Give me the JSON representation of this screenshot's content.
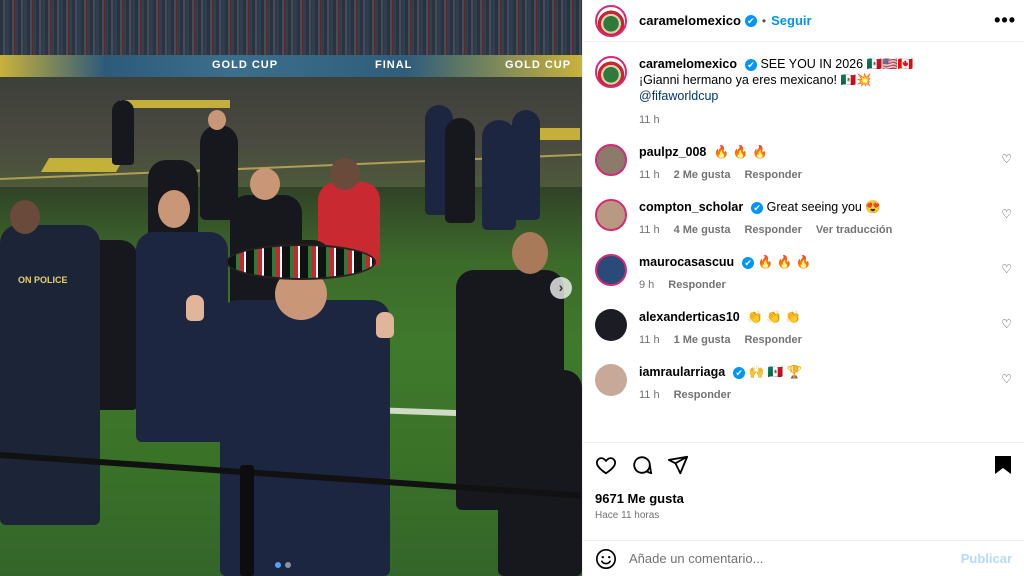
{
  "media": {
    "ad_board_texts": [
      "GOLD CUP",
      "FINAL",
      "GOLD CUP"
    ],
    "jacket_text": "ON POLICE",
    "next_icon": "chevron-right-icon"
  },
  "header": {
    "username": "caramelomexico",
    "verified_glyph": "✔",
    "separator": "•",
    "follow_label": "Seguir",
    "more_label": "•••"
  },
  "caption": {
    "username": "caramelomexico",
    "text_line1": "SEE YOU IN 2026 🇲🇽🇺🇸🇨🇦",
    "text_line2": "¡Gianni hermano ya eres mexicano! 🇲🇽💥",
    "mention": "@fifaworldcup",
    "time": "11 h"
  },
  "comments": [
    {
      "username": "paulpz_008",
      "verified": false,
      "text": "🔥 🔥 🔥",
      "time": "11 h",
      "likes": "2 Me gusta",
      "reply": "Responder",
      "translate": "",
      "avatar_color": "#8c7a6a",
      "story": true
    },
    {
      "username": "compton_scholar",
      "verified": true,
      "text": "Great seeing you 😍",
      "time": "11 h",
      "likes": "4 Me gusta",
      "reply": "Responder",
      "translate": "Ver traducción",
      "avatar_color": "#b89a82",
      "story": true
    },
    {
      "username": "maurocasascuu",
      "verified": true,
      "text": "🔥 🔥 🔥",
      "time": "9 h",
      "likes": "",
      "reply": "Responder",
      "translate": "",
      "avatar_color": "#2a4a7a",
      "story": true
    },
    {
      "username": "alexanderticas10",
      "verified": false,
      "text": "👏 👏 👏",
      "time": "11 h",
      "likes": "1 Me gusta",
      "reply": "Responder",
      "translate": "",
      "avatar_color": "#1c1c24",
      "story": false
    },
    {
      "username": "iamraularriaga",
      "verified": true,
      "text": "🙌 🇲🇽 🏆",
      "time": "11 h",
      "likes": "",
      "reply": "Responder",
      "translate": "",
      "avatar_color": "#c8a898",
      "story": false
    }
  ],
  "actions": {
    "likes": "9671 Me gusta",
    "time": "Hace 11 horas"
  },
  "composer": {
    "placeholder": "Añade un comentario...",
    "publish_label": "Publicar"
  },
  "colors": {
    "accent": "#0095f6",
    "story_ring": "#d62976",
    "muted": "#737373"
  }
}
